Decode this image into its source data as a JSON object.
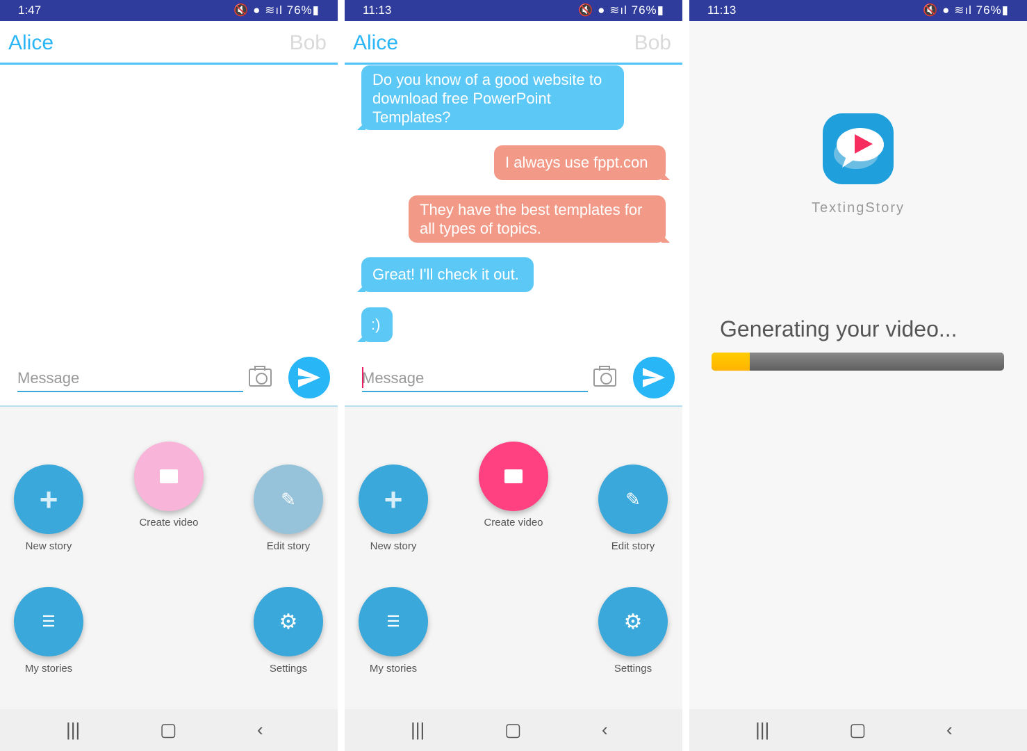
{
  "status": [
    {
      "time": "1:47",
      "battery": "76%"
    },
    {
      "time": "11:13",
      "battery": "76%"
    },
    {
      "time": "11:13",
      "battery": "76%"
    }
  ],
  "header": {
    "left": "Alice",
    "right": "Bob"
  },
  "input": {
    "placeholder": "Message"
  },
  "actions": {
    "new_story": "New story",
    "create_video": "Create video",
    "edit_story": "Edit story",
    "my_stories": "My stories",
    "settings": "Settings"
  },
  "messages": [
    {
      "sender": "Alice",
      "text": "Do you know of a good website to download free PowerPoint Templates?"
    },
    {
      "sender": "Bob",
      "text": "I always use fppt.con"
    },
    {
      "sender": "Bob",
      "text": "They have the best templates for all types of topics."
    },
    {
      "sender": "Alice",
      "text": "Great! I'll check it out."
    },
    {
      "sender": "Alice",
      "text": ":)"
    }
  ],
  "generating": {
    "app_name": "TextingStory",
    "message": "Generating your video...",
    "progress_percent": 13
  },
  "colors": {
    "status_bar": "#2F3C9B",
    "accent": "#29B6F6",
    "alice_bubble": "#5BC8F5",
    "bob_bubble": "#F29A87",
    "create_video": "#FF4081",
    "fab": "#3AA8DA",
    "progress": "#FFC107"
  }
}
